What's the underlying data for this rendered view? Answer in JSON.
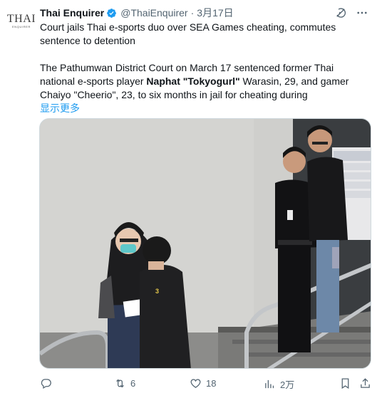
{
  "account": {
    "logo_main": "THAI",
    "logo_sub": "ENQUIRER",
    "name": "Thai Enquirer",
    "handle": "@ThaiEnquirer",
    "separator": "·",
    "date": "3月17日"
  },
  "tweet": {
    "headline": "Court jails Thai e-sports duo over SEA Games cheating, commutes sentence to detention",
    "body_part1": "The Pathumwan District Court on March 17 sentenced former Thai national e-sports player ",
    "body_bold1": "Naphat \"Tokyogurl\"",
    "body_part2": " Warasin, 29, and gamer Chaiyo \"Cheerio\", 23, to six months in jail for cheating during",
    "show_more": "显示更多"
  },
  "actions": {
    "reply_count": "",
    "retweet_count": "6",
    "like_count": "18",
    "views_count": "2万"
  },
  "colors": {
    "link": "#1d9bf0",
    "secondary_text": "#536471",
    "verified": "#1d9bf0"
  },
  "icons": [
    "verified-badge-icon",
    "grok-icon",
    "more-icon",
    "reply-icon",
    "retweet-icon",
    "like-icon",
    "views-icon",
    "bookmark-icon",
    "share-icon"
  ]
}
